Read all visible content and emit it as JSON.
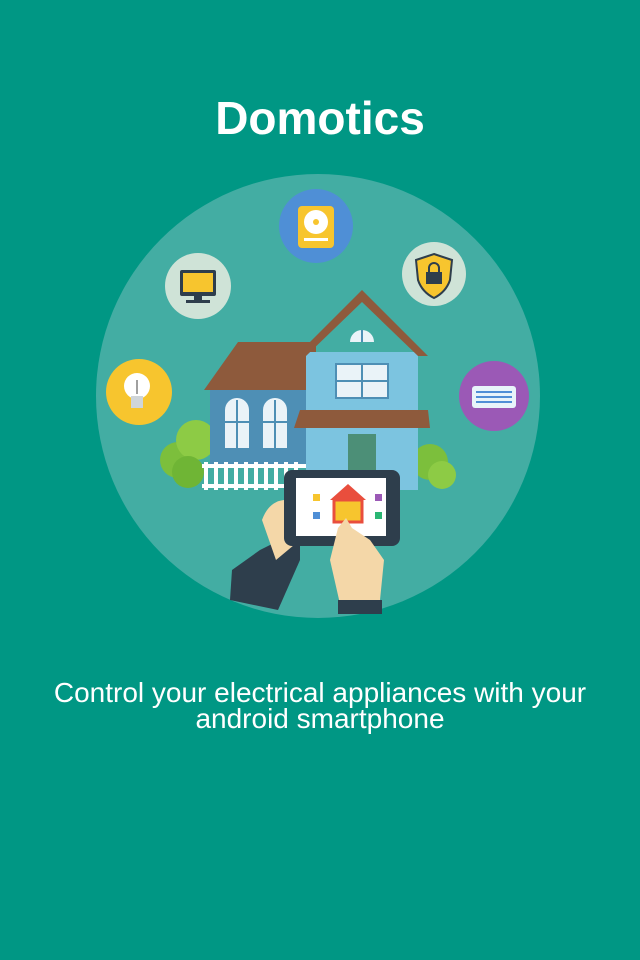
{
  "splash": {
    "title": "Domotics",
    "tagline": "Control your electrical appliances with your android smartphone"
  },
  "illustration": {
    "subject": "smart home controlled from a tablet",
    "icons": [
      "light-bulb-icon",
      "monitor-icon",
      "fan-icon",
      "security-lock-icon",
      "heater-icon",
      "house-icon"
    ]
  },
  "colors": {
    "background": "#009784",
    "circle": "#43ADA3",
    "text": "#ffffff"
  }
}
